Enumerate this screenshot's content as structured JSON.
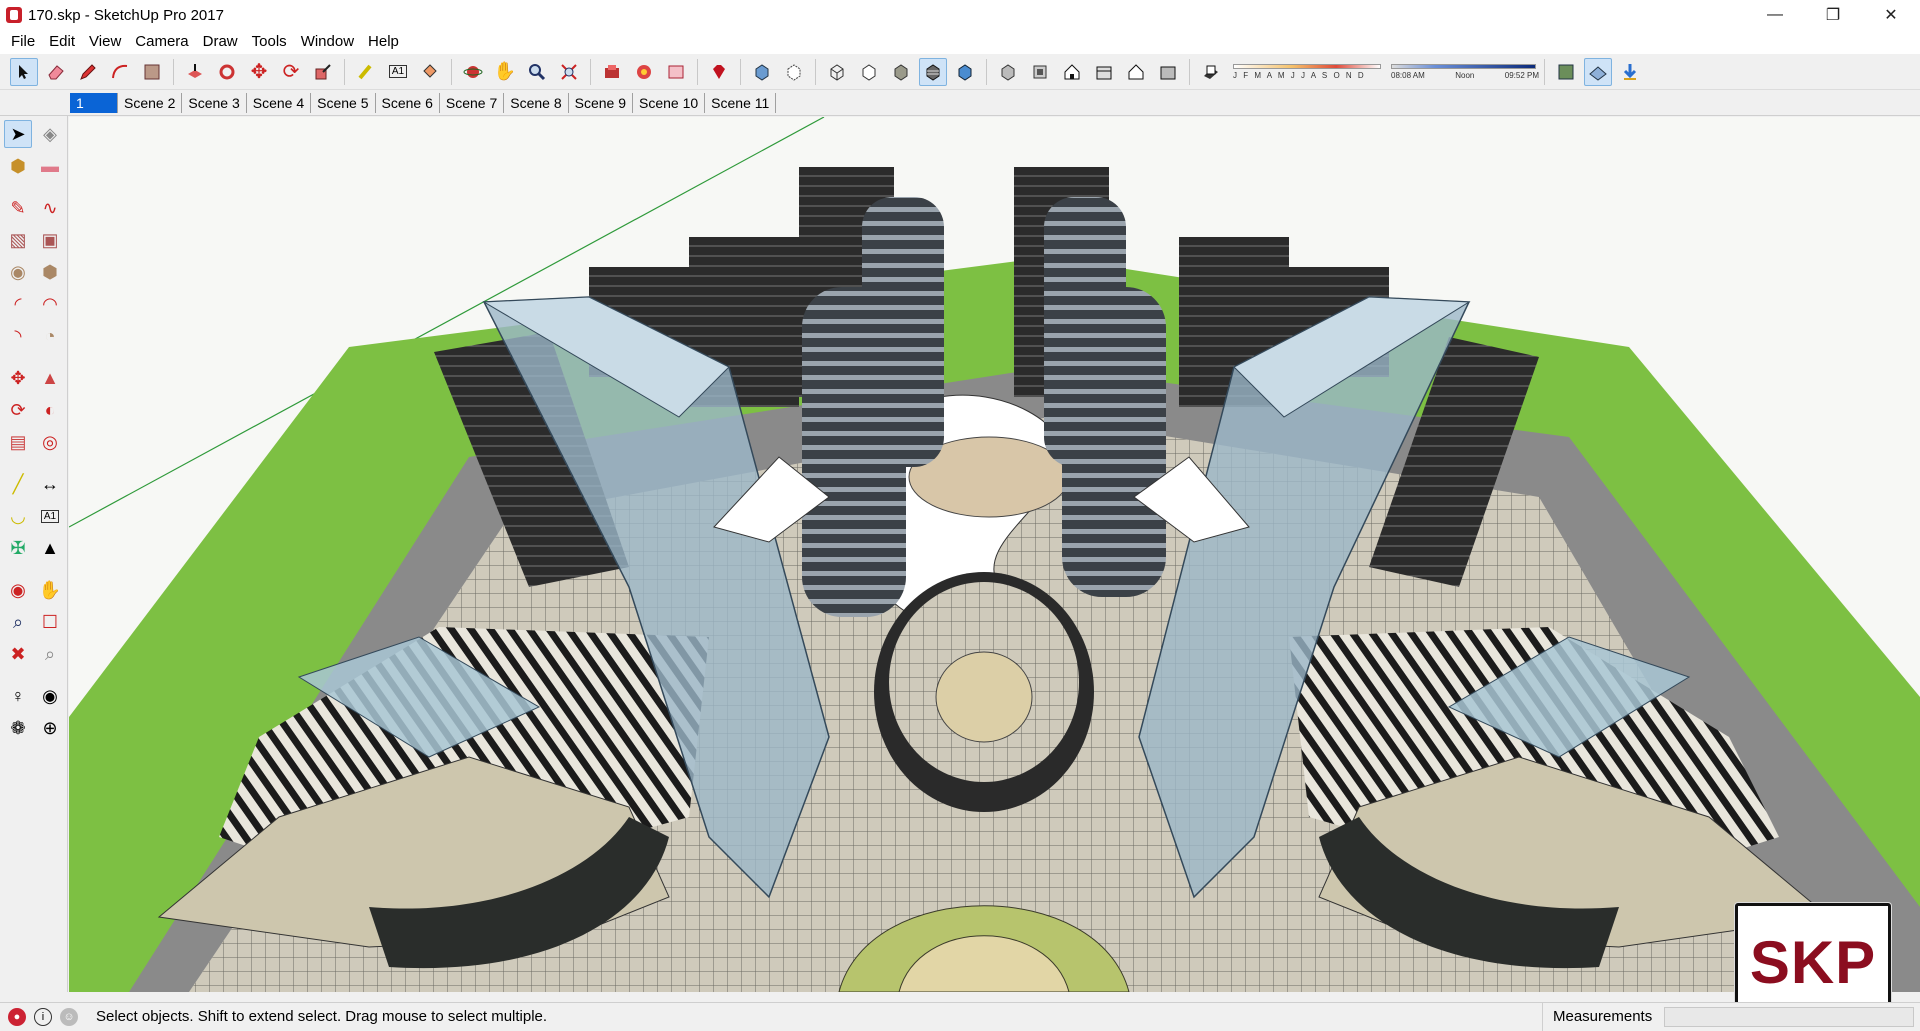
{
  "window": {
    "title": "170.skp - SketchUp Pro 2017",
    "controls": [
      "minimize",
      "restore",
      "close"
    ]
  },
  "menu": [
    "File",
    "Edit",
    "View",
    "Camera",
    "Draw",
    "Tools",
    "Window",
    "Help"
  ],
  "toolbar": {
    "groups": [
      [
        "select-icon",
        "eraser-icon",
        "pencil-icon",
        "arc-icon",
        "rectangle-icon"
      ],
      [
        "push-pull-icon",
        "follow-me-icon",
        "move-icon",
        "rotate-icon",
        "scale-icon"
      ],
      [
        "tape-measure-icon",
        "text-icon",
        "paint-bucket-icon"
      ],
      [
        "orbit-icon",
        "pan-icon",
        "zoom-icon",
        "zoom-extents-icon"
      ],
      [
        "warehouse-icon",
        "extension-icon",
        "send-to-layout-icon"
      ],
      [
        "ruby-icon"
      ],
      [
        "xray-icon",
        "back-edges-icon"
      ],
      [
        "wireframe-icon",
        "hidden-line-icon",
        "shaded-icon",
        "shaded-textures-icon",
        "monochrome-icon"
      ],
      [
        "iso-view-icon",
        "top-view-icon",
        "front-view-icon",
        "right-view-icon",
        "back-view-icon",
        "left-view-icon"
      ]
    ],
    "shadows": {
      "months": "J F M A M J J A S O N D",
      "time_start": "08:08 AM",
      "time_mid": "Noon",
      "time_end": "09:52 PM"
    }
  },
  "scenes": [
    "1",
    "Scene 2",
    "Scene 3",
    "Scene 4",
    "Scene 5",
    "Scene 6",
    "Scene 7",
    "Scene 8",
    "Scene 9",
    "Scene 10",
    "Scene 11"
  ],
  "status": {
    "message": "Select objects. Shift to extend select. Drag mouse to select multiple.",
    "measurements_label": "Measurements"
  },
  "badge": {
    "text": "SKP"
  },
  "colors": {
    "selected_tab": "#0a64d6",
    "lawn": "#7dc043",
    "glass": "#9bb6c8",
    "badge_text": "#8b0d1f"
  }
}
